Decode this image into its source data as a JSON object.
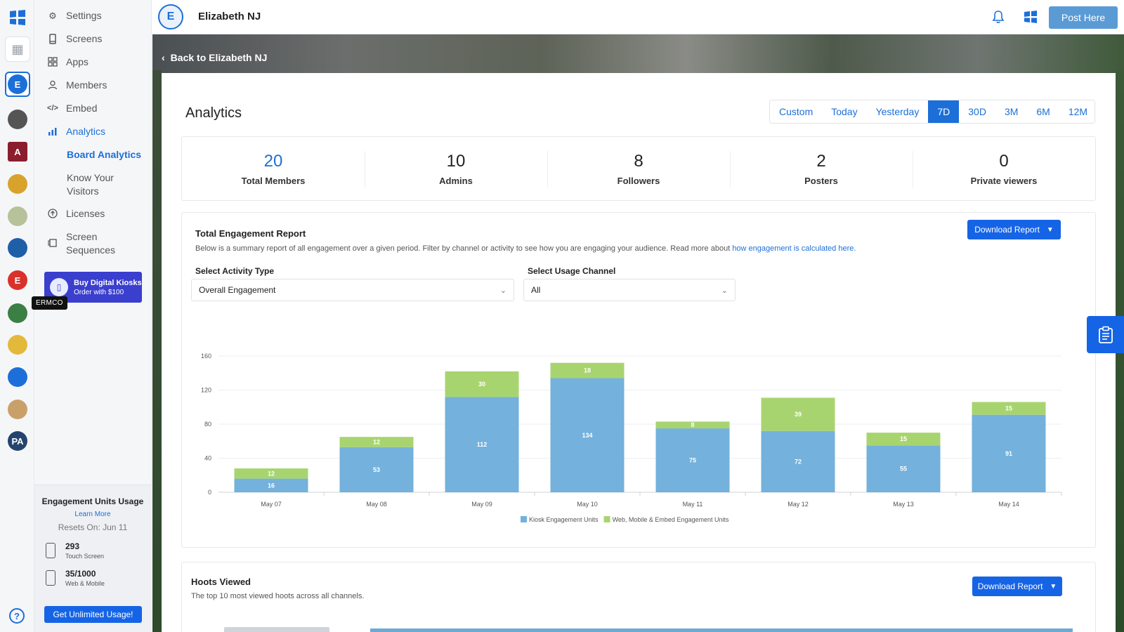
{
  "colors": {
    "accent": "#1c6fd8",
    "kiosk": "#74b1dc",
    "web": "#a8d46f",
    "button": "#1664e6",
    "post_here": "#5a9bd6"
  },
  "sidebar": {
    "items": [
      {
        "label": "Settings",
        "icon": "gear-icon"
      },
      {
        "label": "Screens",
        "icon": "tablet-icon"
      },
      {
        "label": "Apps",
        "icon": "apps-grid-icon"
      },
      {
        "label": "Members",
        "icon": "user-icon"
      },
      {
        "label": "Embed",
        "icon": "code-icon"
      },
      {
        "label": "Analytics",
        "icon": "bar-chart-icon"
      },
      {
        "label": "Licenses",
        "icon": "upload-circle-icon"
      },
      {
        "label": "Screen Sequences",
        "icon": "sequence-icon"
      }
    ],
    "analytics_sub": {
      "board": "Board Analytics",
      "visitors": "Know Your Visitors"
    },
    "promo": {
      "title": "Buy Digital Kiosks",
      "subtitle": "Order with $100"
    },
    "usage": {
      "title": "Engagement Units Usage",
      "learn_more": "Learn More",
      "resets": "Resets On: Jun 11",
      "touch_value": "293",
      "touch_label": "Touch Screen",
      "web_value": "35/1000",
      "web_label": "Web & Mobile",
      "cta": "Get Unlimited Usage!"
    }
  },
  "rail": {
    "tooltip": "ERMCO",
    "orgs": [
      {
        "name": "grid",
        "color": "#9aa0aa"
      },
      {
        "name": "elizabeth",
        "color": "#1c6fd8",
        "letter": "E"
      },
      {
        "name": "org-3",
        "color": "#555555",
        "letter": ""
      },
      {
        "name": "org-4",
        "color": "#8b1e2d",
        "letter": "A"
      },
      {
        "name": "org-5",
        "color": "#d8a32c",
        "letter": ""
      },
      {
        "name": "org-6",
        "color": "#b7c19a",
        "letter": ""
      },
      {
        "name": "columbia",
        "color": "#1f5fa8",
        "letter": ""
      },
      {
        "name": "ermco",
        "color": "#d9312b",
        "letter": "E"
      },
      {
        "name": "org-9",
        "color": "#3a7f44",
        "letter": ""
      },
      {
        "name": "org-10",
        "color": "#e2b93b",
        "letter": ""
      },
      {
        "name": "org-11",
        "color": "#1c6fd8",
        "letter": ""
      },
      {
        "name": "org-12",
        "color": "#c9a06a",
        "letter": ""
      },
      {
        "name": "org-13",
        "color": "#23446e",
        "letter": "PA"
      }
    ]
  },
  "header": {
    "org_name": "Elizabeth NJ",
    "post_here": "Post Here",
    "back_link": "Back to Elizabeth NJ"
  },
  "main": {
    "title": "Analytics",
    "range_tabs": [
      "Custom",
      "Today",
      "Yesterday",
      "7D",
      "30D",
      "3M",
      "6M",
      "12M"
    ],
    "active_range": "7D",
    "stats": [
      {
        "value": "20",
        "label": "Total Members"
      },
      {
        "value": "10",
        "label": "Admins"
      },
      {
        "value": "8",
        "label": "Followers"
      },
      {
        "value": "2",
        "label": "Posters"
      },
      {
        "value": "0",
        "label": "Private viewers"
      }
    ],
    "engagement": {
      "title": "Total Engagement Report",
      "desc": "Below is a summary report of all engagement over a given period. Filter by channel or activity to see how you are engaging your audience. Read more about ",
      "desc_link": "how engagement is calculated here.",
      "download": "Download Report",
      "activity_label": "Select Activity Type",
      "activity_value": "Overall Engagement",
      "channel_label": "Select Usage Channel",
      "channel_value": "All"
    },
    "hoots": {
      "title": "Hoots Viewed",
      "desc": "The top 10 most viewed hoots across all channels.",
      "download": "Download Report"
    }
  },
  "chart_data": {
    "type": "bar",
    "stacked": true,
    "categories": [
      "May 07",
      "May 08",
      "May 09",
      "May 10",
      "May 11",
      "May 12",
      "May 13",
      "May 14"
    ],
    "series": [
      {
        "name": "Kiosk Engagement Units",
        "values": [
          16,
          53,
          112,
          134,
          75,
          72,
          55,
          91
        ]
      },
      {
        "name": "Web, Mobile & Embed Engagement Units",
        "values": [
          12,
          12,
          30,
          18,
          8,
          39,
          15,
          15
        ]
      }
    ],
    "ylim": [
      0,
      160
    ],
    "yticks": [
      0,
      40,
      80,
      120,
      160
    ],
    "grid": true,
    "legend": "bottom-center"
  }
}
